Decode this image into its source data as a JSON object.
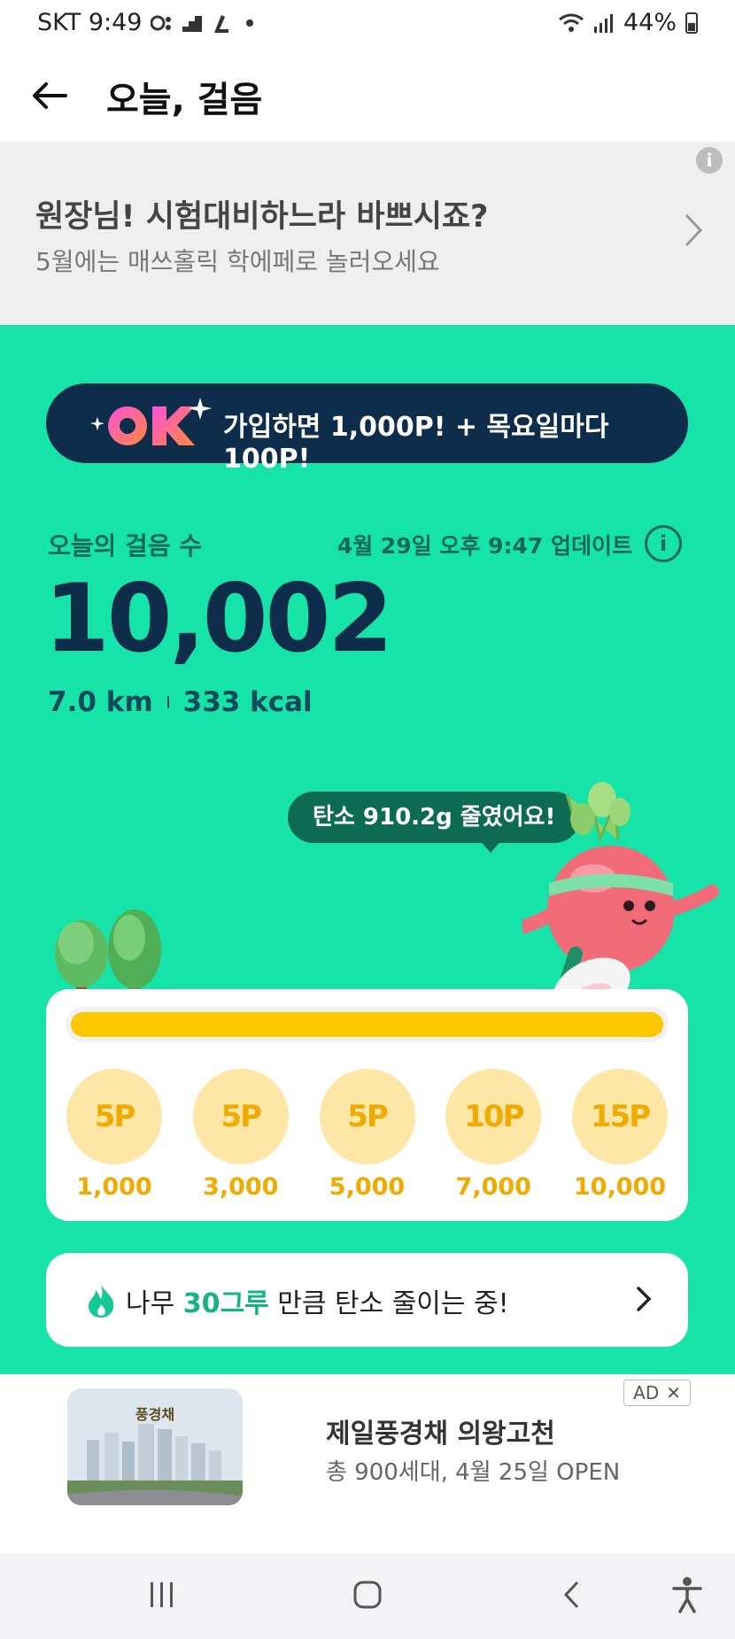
{
  "status_bar": {
    "carrier_time": "SKT 9:49",
    "battery": "44%"
  },
  "header": {
    "title": "오늘, 걸음"
  },
  "promo_banner": {
    "title": "원장님! 시험대비하느라 바쁘시죠?",
    "subtitle": "5월에는 매쓰홀릭 학에페로 놀러오세요",
    "info_icon": "i"
  },
  "ok_banner": {
    "logo": "OK",
    "text": "가입하면 1,000P! + 목요일마다 100P!"
  },
  "steps": {
    "label": "오늘의 걸음 수",
    "updated": "4월 29일 오후 9:47 업데이트",
    "info_icon": "i",
    "count": "10,002",
    "distance": "7.0 km",
    "calories": "333 kcal",
    "progress": 1.0
  },
  "carbon_bubble": "탄소 910.2g 줄였어요!",
  "rewards": [
    {
      "points": "5P",
      "steps": "1,000"
    },
    {
      "points": "5P",
      "steps": "3,000"
    },
    {
      "points": "5P",
      "steps": "5,000"
    },
    {
      "points": "10P",
      "steps": "7,000"
    },
    {
      "points": "15P",
      "steps": "10,000"
    }
  ],
  "tree_status": {
    "prefix": "나무 ",
    "count": "30그루",
    "suffix": " 만큼 탄소 줄이는 중!"
  },
  "ad": {
    "badge": "AD",
    "close": "✕",
    "brand": "풍경채",
    "title": "제일풍경채 의왕고천",
    "subtitle": "총 900세대, 4월 25일 OPEN"
  },
  "colors": {
    "green": "#15e3a8",
    "navy": "#0d2d4b",
    "yellow": "#fdc800",
    "coin": "#fee6a6"
  }
}
